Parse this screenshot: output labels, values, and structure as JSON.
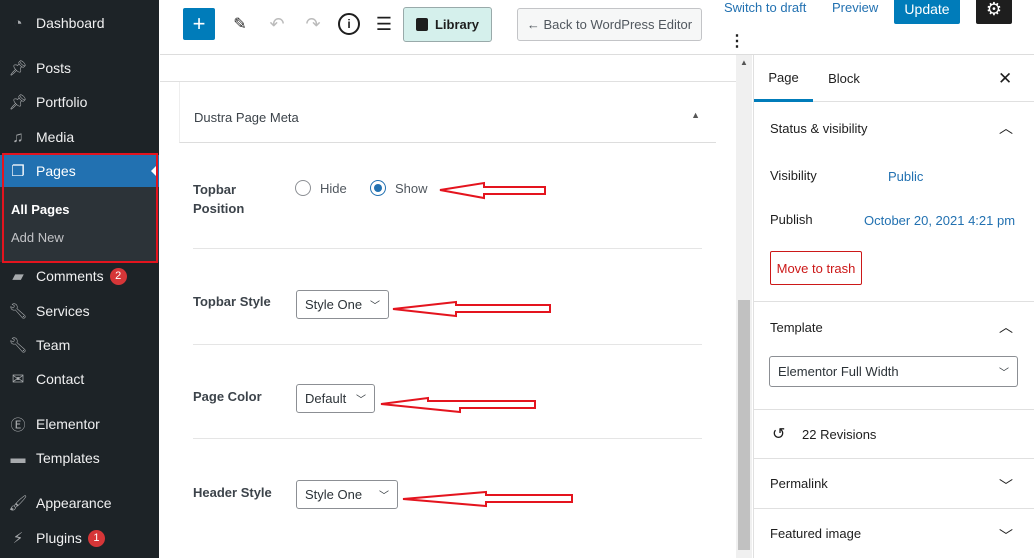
{
  "sidebar": {
    "items": [
      {
        "label": "Dashboard",
        "icon": "dashboard-icon"
      },
      {
        "label": "Posts",
        "icon": "pin-icon"
      },
      {
        "label": "Portfolio",
        "icon": "pin-icon"
      },
      {
        "label": "Media",
        "icon": "media-icon"
      },
      {
        "label": "Pages",
        "icon": "pages-icon",
        "active": true
      },
      {
        "label": "Comments",
        "icon": "comment-icon",
        "badge": "2"
      },
      {
        "label": "Services",
        "icon": "wrench-icon"
      },
      {
        "label": "Team",
        "icon": "wrench-icon"
      },
      {
        "label": "Contact",
        "icon": "mail-icon"
      },
      {
        "label": "Elementor",
        "icon": "elementor-icon"
      },
      {
        "label": "Templates",
        "icon": "folder-icon"
      },
      {
        "label": "Appearance",
        "icon": "brush-icon"
      },
      {
        "label": "Plugins",
        "icon": "plugin-icon",
        "badge": "1"
      }
    ],
    "submenu": [
      "All Pages",
      "Add New"
    ]
  },
  "toolbar": {
    "library": "Library",
    "back": "← Back to WordPress Editor",
    "switch_draft": "Switch to draft",
    "preview": "Preview",
    "update": "Update"
  },
  "meta": {
    "title": "Dustra Page Meta",
    "topbar_position": {
      "label": "Topbar Position",
      "options": [
        "Hide",
        "Show"
      ],
      "selected": "Show"
    },
    "topbar_style": {
      "label": "Topbar Style",
      "value": "Style One"
    },
    "page_color": {
      "label": "Page Color",
      "value": "Default"
    },
    "header_style": {
      "label": "Header Style",
      "value": "Style One"
    }
  },
  "panel": {
    "tabs": [
      "Page",
      "Block"
    ],
    "active_tab": "Page",
    "status": {
      "title": "Status & visibility",
      "visibility_label": "Visibility",
      "visibility": "Public",
      "publish_label": "Publish",
      "publish": "October 20, 2021 4:21 pm",
      "trash": "Move to trash"
    },
    "template": {
      "title": "Template",
      "value": "Elementor Full Width"
    },
    "revisions": "22 Revisions",
    "permalink": "Permalink",
    "featured": "Featured image"
  },
  "colors": {
    "accent": "#007cba",
    "sidebar": "#1d2327",
    "highlight": "#2271b1",
    "annotation": "#e4141e"
  }
}
